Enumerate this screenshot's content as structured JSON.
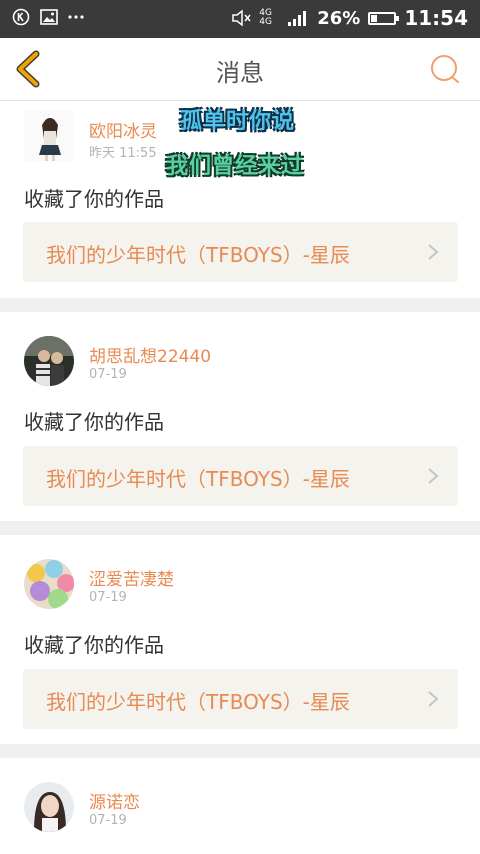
{
  "status_bar": {
    "network_top": "4G 4G",
    "battery": "26%",
    "battery_level": 0.26,
    "time": "11:54"
  },
  "header": {
    "title": "消息",
    "icons": [
      "chevron-left-icon",
      "search-icon"
    ]
  },
  "colors": {
    "accent": "#e88a52",
    "back_arrow": "#f0a400",
    "status_bar_bg": "#3a3a3a"
  },
  "overlay": {
    "line1": "孤单时你说",
    "line2": "我们曾经来过"
  },
  "messages": [
    {
      "user": "欧阳冰灵",
      "time": "昨天 11:55",
      "action": "收藏了你的作品",
      "work": "我们的少年时代（TFBOYS）-星辰"
    },
    {
      "user": "胡思乱想22440",
      "time": "07-19",
      "action": "收藏了你的作品",
      "work": "我们的少年时代（TFBOYS）-星辰"
    },
    {
      "user": "涩爱苦凄楚",
      "time": "07-19",
      "action": "收藏了你的作品",
      "work": "我们的少年时代（TFBOYS）-星辰"
    },
    {
      "user": "源诺恋",
      "time": "07-19",
      "action": "",
      "work": ""
    }
  ]
}
